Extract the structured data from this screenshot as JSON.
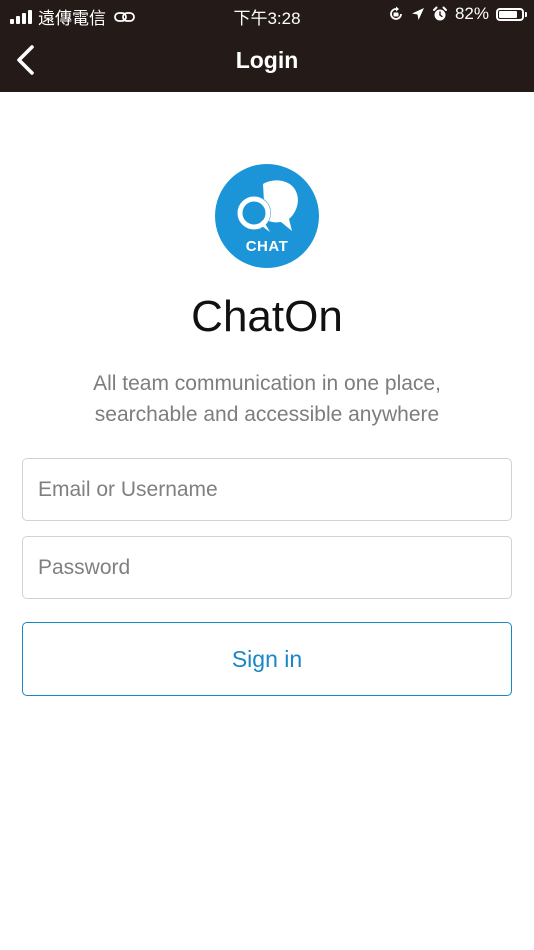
{
  "status_bar": {
    "carrier": "遠傳電信",
    "time": "下午3:28",
    "battery_percent": "82%",
    "battery_level": 0.82,
    "icons": [
      "signal-bars-icon",
      "link-icon",
      "orientation-lock-icon",
      "location-arrow-icon",
      "alarm-icon",
      "battery-icon"
    ]
  },
  "nav": {
    "title": "Login",
    "back_icon": "chevron-left-icon"
  },
  "app": {
    "logo_text": "CHAT",
    "name": "ChatOn",
    "tagline": "All team communication in one place, searchable and accessible anywhere"
  },
  "form": {
    "email_placeholder": "Email or Username",
    "email_value": "",
    "password_placeholder": "Password",
    "password_value": "",
    "signin_label": "Sign in"
  },
  "colors": {
    "nav_background": "#241a17",
    "accent": "#1a86c6",
    "logo_background": "#1b95d8"
  }
}
